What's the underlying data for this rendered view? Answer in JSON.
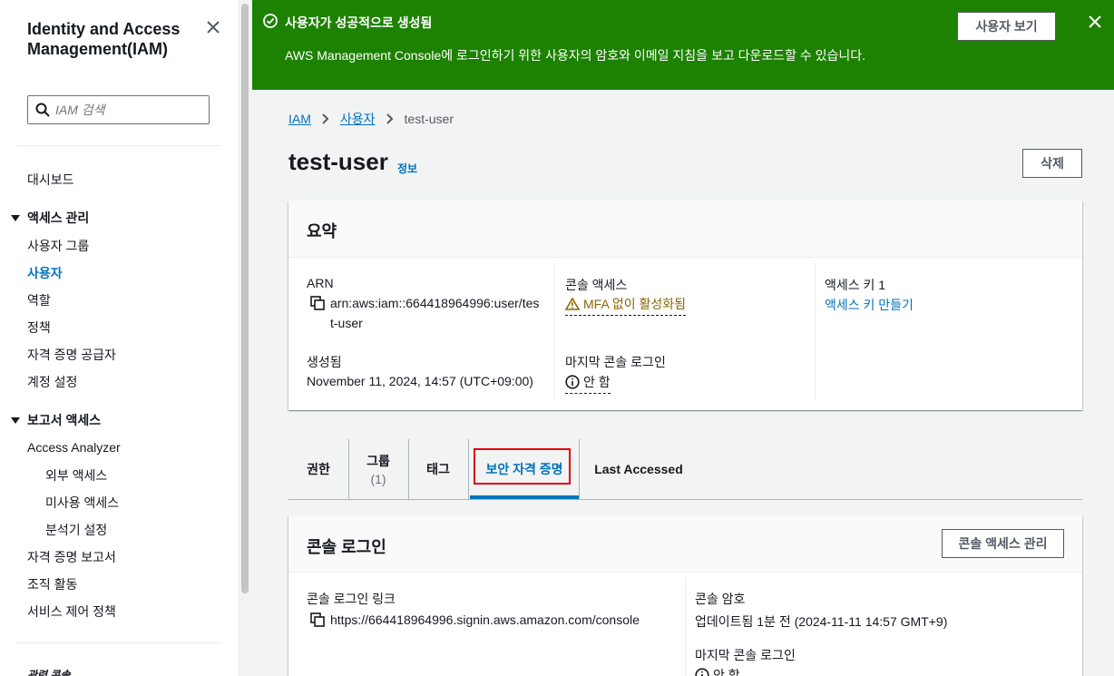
{
  "sidebar": {
    "title": "Identity and Access Management(IAM)",
    "search_placeholder": "IAM 검색",
    "dashboard": "대시보드",
    "section_access": "액세스 관리",
    "access_items": [
      "사용자 그룹",
      "사용자",
      "역할",
      "정책",
      "자격 증명 공급자",
      "계정 설정"
    ],
    "section_reports": "보고서 액세스",
    "report_items": [
      "Access Analyzer",
      "외부 액세스",
      "미사용 액세스",
      "분석기 설정",
      "자격 증명 보고서",
      "조직 활동",
      "서비스 제어 정책"
    ],
    "related": "관련 콘솔"
  },
  "flash": {
    "header": "사용자가 성공적으로 생성됨",
    "content": "AWS Management Console에 로그인하기 위한 사용자의 암호와 이메일 지침을 보고 다운로드할 수 있습니다.",
    "button": "사용자 보기",
    "color": "#1d8102"
  },
  "breadcrumb": [
    "IAM",
    "사용자",
    "test-user"
  ],
  "page": {
    "title": "test-user",
    "info": "정보",
    "delete": "삭제"
  },
  "summary": {
    "title": "요약",
    "arn_label": "ARN",
    "arn_line1": "arn:aws:iam::664418964996:user/tes",
    "arn_line2": "t-user",
    "created_label": "생성됨",
    "created_value": "November 11, 2024, 14:57 (UTC+09:00)",
    "console_access_label": "콘솔 액세스",
    "console_access_value": "MFA 없이 활성화됨",
    "last_login_label": "마지막 콘솔 로그인",
    "last_login_value": "안 함",
    "access_key_label": "액세스 키 1",
    "access_key_link": "액세스 키 만들기"
  },
  "tabs": [
    {
      "label": "권한",
      "sub": ""
    },
    {
      "label": "그룹",
      "sub": "(1)"
    },
    {
      "label": "태그",
      "sub": ""
    },
    {
      "label": "보안 자격 증명",
      "sub": ""
    },
    {
      "label": "Last Accessed",
      "sub": ""
    }
  ],
  "console_signin": {
    "title": "콘솔 로그인",
    "manage_button": "콘솔 액세스 관리",
    "link_label": "콘솔 로그인 링크",
    "link_value": "https://664418964996.signin.aws.amazon.com/console",
    "password_label": "콘솔 암호",
    "password_value": "업데이트됨 1분 전 (2024-11-11 14:57 GMT+9)",
    "last_login_label": "마지막 콘솔 로그인",
    "last_login_value": "안 함"
  },
  "colors": {
    "link": "#0073bb",
    "warning": "#8d6605",
    "highlight": "#e0000b"
  }
}
